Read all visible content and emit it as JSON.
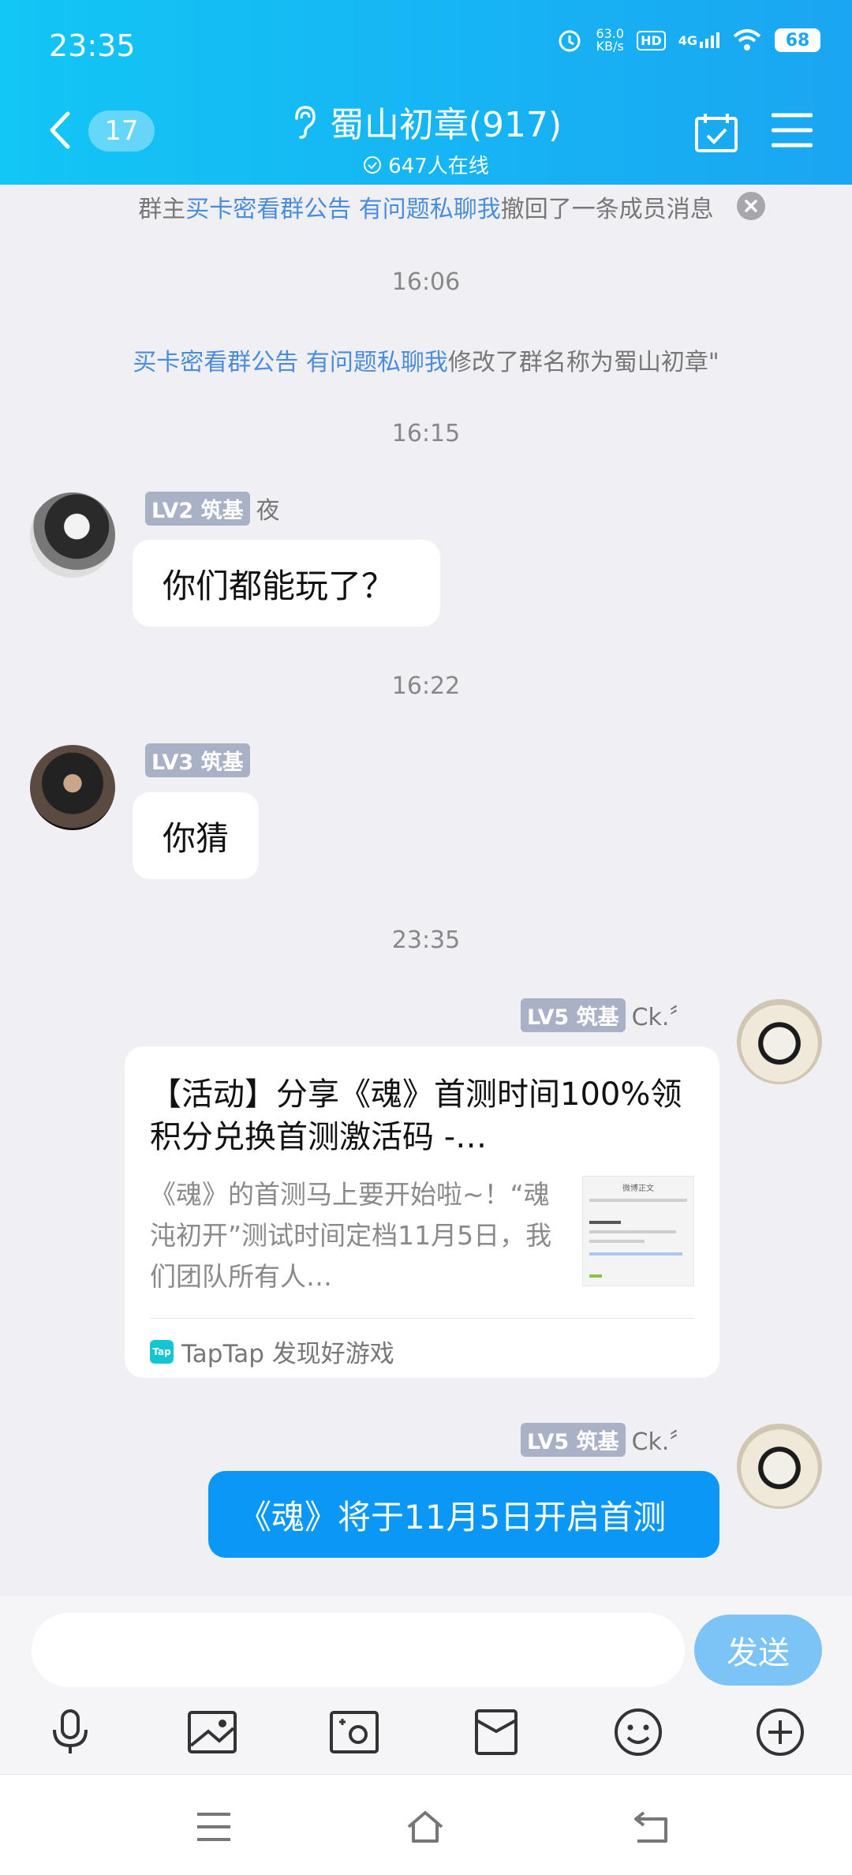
{
  "status_bar": {
    "time": "23:35",
    "net_speed": "63.0",
    "net_unit": "KB/s",
    "hd": "HD",
    "signal": "4G",
    "battery": "68"
  },
  "header": {
    "unread_count": "17",
    "title": "蜀山初章(917)",
    "online": "647人在线"
  },
  "notices": {
    "recall_prefix": "群主",
    "recall_name": "买卡密看群公告 有问题私聊我",
    "recall_suffix": "撤回了一条成员消息",
    "rename_name": "买卡密看群公告 有问题私聊我",
    "rename_suffix": "修改了群名称为蜀山初章\""
  },
  "times": [
    "16:06",
    "16:15",
    "16:22",
    "23:35"
  ],
  "messages": [
    {
      "level": "LV2 筑基",
      "sender": "夜",
      "text": "你们都能玩了？"
    },
    {
      "level": "LV3 筑基",
      "sender": "",
      "text": "你猜"
    },
    {
      "level": "LV5 筑基",
      "sender": "Ck.〞",
      "card": {
        "title": "【活动】分享《魂》首测时间100%领积分兑换首测激活码 -…",
        "desc": "《魂》的首测马上要开始啦~！“魂沌初开”测试时间定档11月5日，我们团队所有人…",
        "thumb_title": "微博正文",
        "source_icon": "Tap",
        "source": "TapTap 发现好游戏"
      }
    },
    {
      "level": "LV5 筑基",
      "sender": "Ck.〞",
      "text": "《魂》将于11月5日开启首测"
    }
  ],
  "input": {
    "placeholder": "",
    "send_label": "发送"
  },
  "colors": {
    "header_start": "#12c6f5",
    "header_end": "#1aa6f2",
    "my_bubble": "#0a97f5",
    "link": "#4a8ddc",
    "send_button": "#7cc4f6"
  }
}
